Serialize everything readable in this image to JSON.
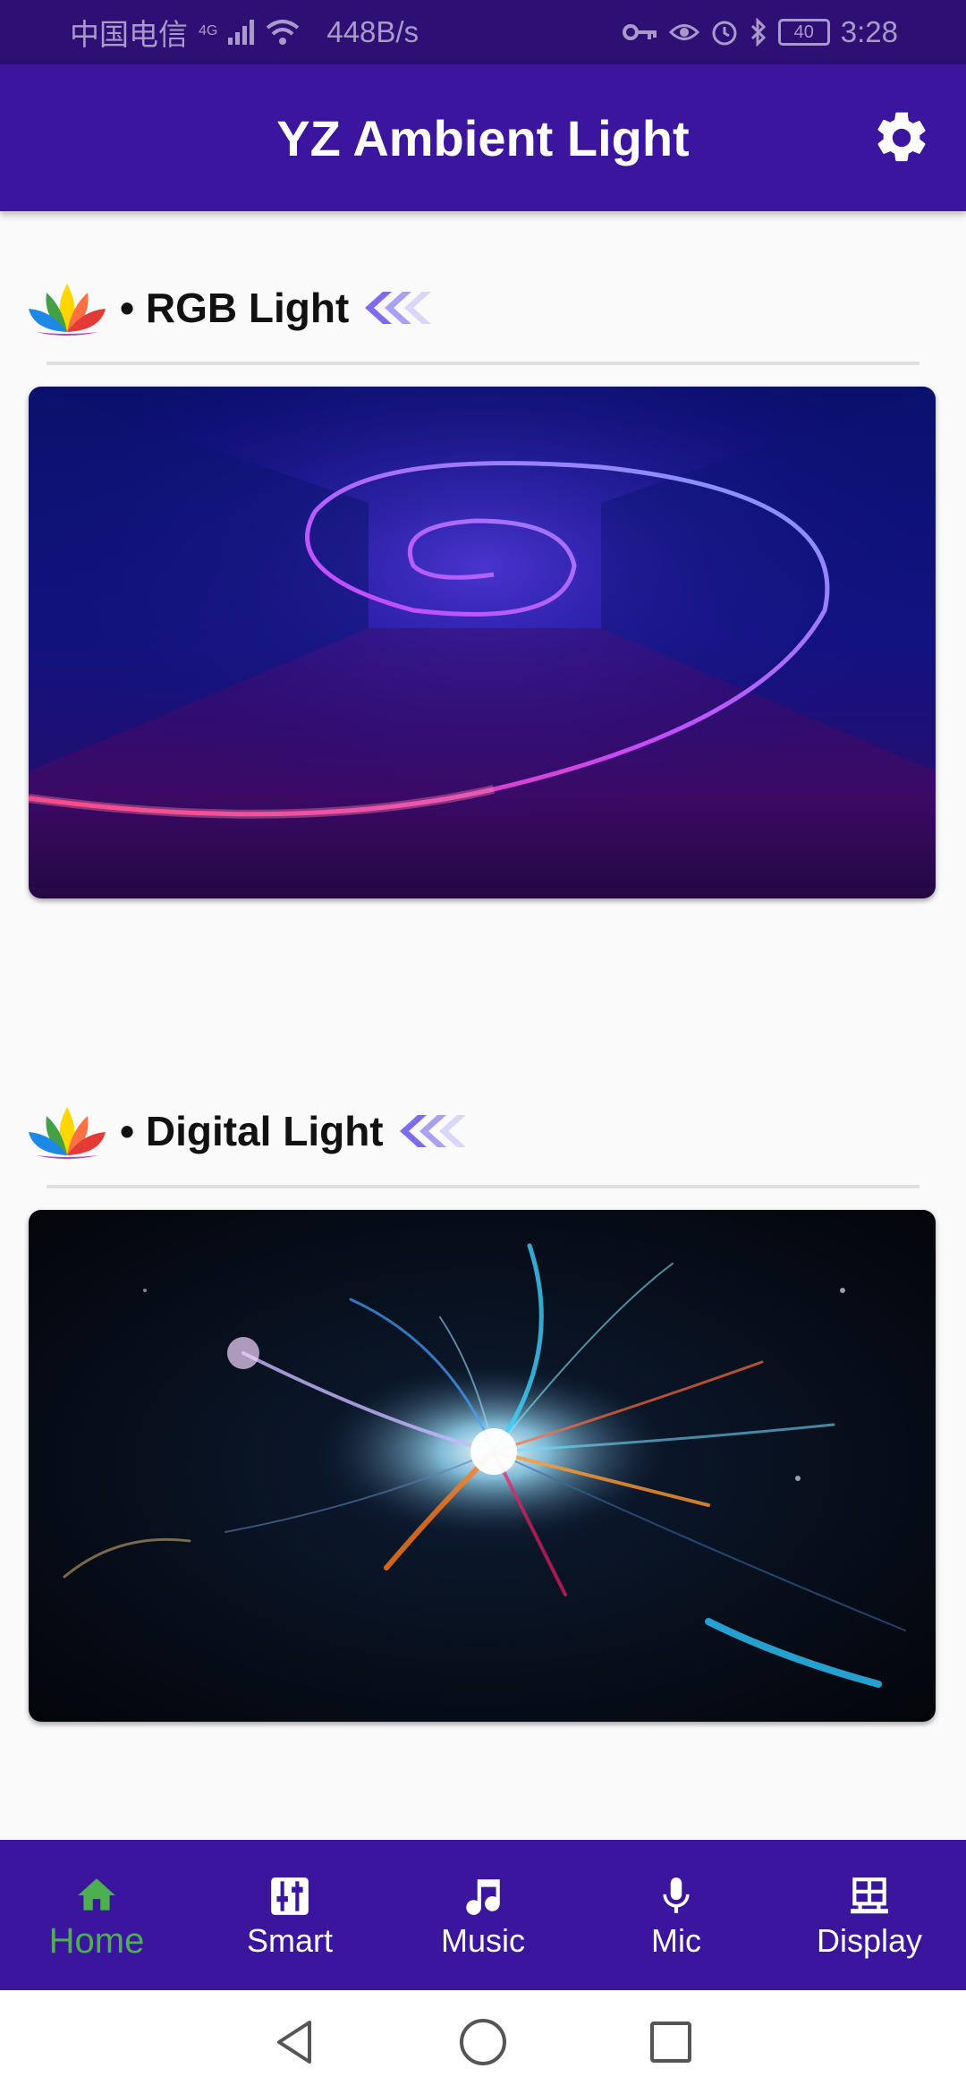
{
  "status_bar": {
    "carrier": "中国电信",
    "network": "4G",
    "speed": "448B/s",
    "battery": "40",
    "time": "3:28"
  },
  "app_bar": {
    "title": "YZ Ambient Light",
    "settings_icon": "gear-icon"
  },
  "sections": [
    {
      "title": "• RGB Light",
      "icon": "lotus-icon",
      "image": "neon-spiral-image"
    },
    {
      "title": "• Digital Light",
      "icon": "lotus-icon",
      "image": "light-streaks-image"
    }
  ],
  "bottom_nav": {
    "items": [
      {
        "label": "Home",
        "icon": "home-icon",
        "active": true
      },
      {
        "label": "Smart",
        "icon": "sliders-icon",
        "active": false
      },
      {
        "label": "Music",
        "icon": "music-note-icon",
        "active": false
      },
      {
        "label": "Mic",
        "icon": "microphone-icon",
        "active": false
      },
      {
        "label": "Display",
        "icon": "display-icon",
        "active": false
      }
    ],
    "active_color": "#4caf50"
  },
  "colors": {
    "status_bar": "#2e1075",
    "app_bar": "#3b159d",
    "background": "#fafafa"
  }
}
